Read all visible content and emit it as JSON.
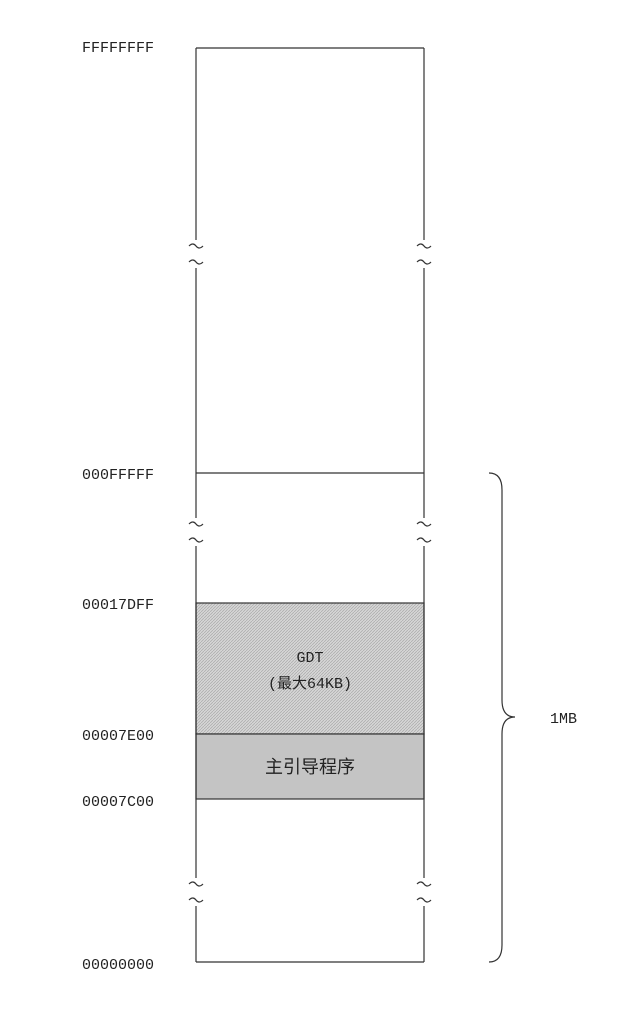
{
  "memory_map": {
    "addresses": {
      "top": "FFFFFFFF",
      "one_mb_end": "000FFFFF",
      "gdt_end": "00017DFF",
      "mbr_end": "00007E00",
      "mbr_start": "00007C00",
      "bottom": "00000000"
    },
    "regions": {
      "gdt_title": "GDT",
      "gdt_subtitle": "(最大64KB)",
      "mbr_label": "主引导程序"
    },
    "brace_label": "1MB",
    "colors": {
      "gdt_fill": "#cfcfcf",
      "mbr_fill": "#c4c4c4",
      "outline": "#333333"
    }
  }
}
